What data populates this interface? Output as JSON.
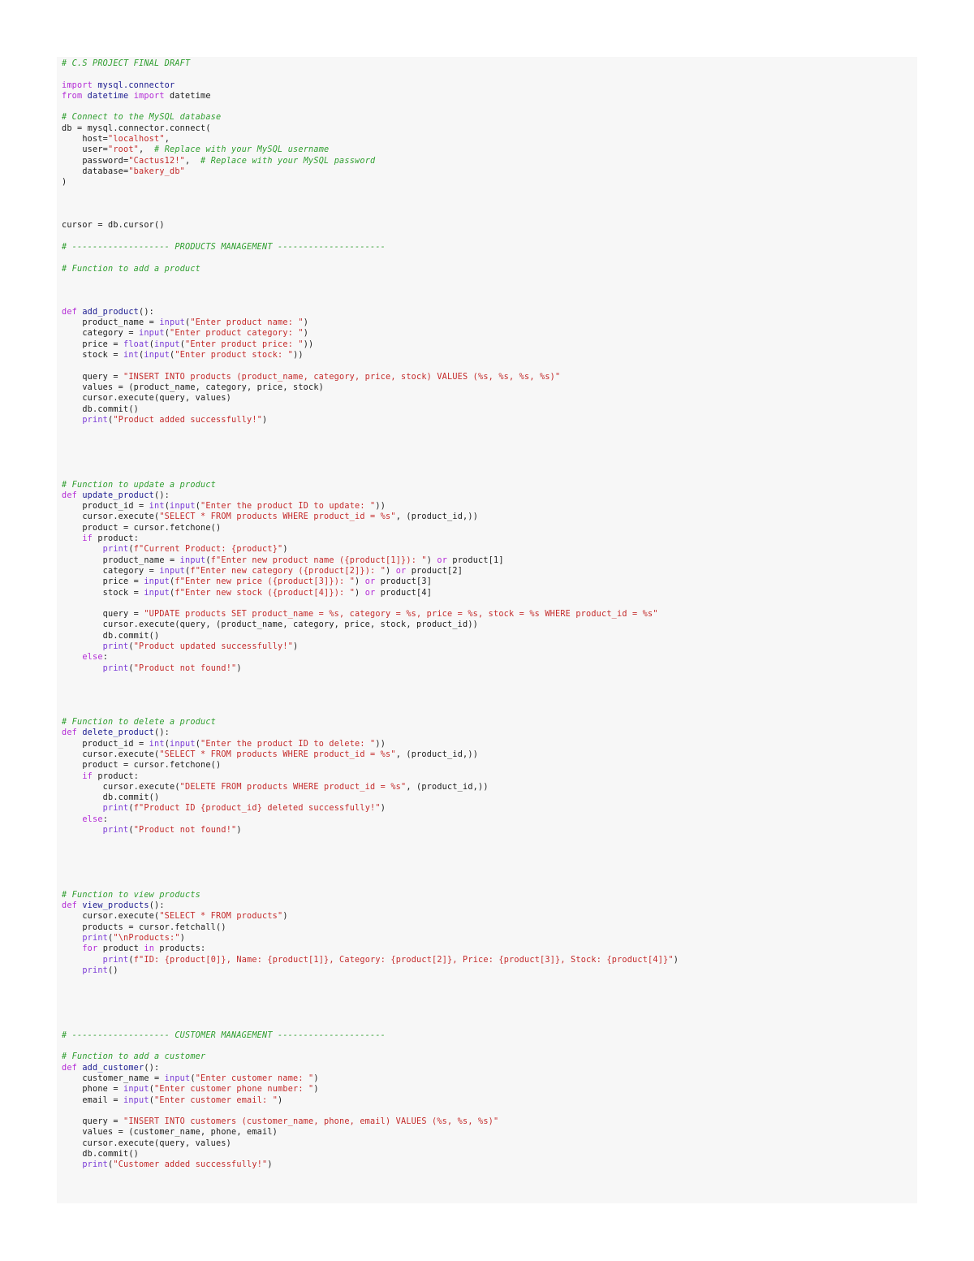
{
  "document": {
    "language": "python",
    "colors": {
      "comment": "#2f9e2f",
      "keyword": "#b32bd6",
      "string": "#c42a2a",
      "function_name": "#1a1a8f",
      "builtin": "#7a3ad6",
      "plain": "#1a1a1a",
      "panel_background": "#f7f7f7"
    },
    "lines": [
      [
        [
          "c",
          "# C.S PROJECT FINAL DRAFT"
        ]
      ],
      [],
      [
        [
          "k",
          "import "
        ],
        [
          "f",
          "mysql.connector"
        ]
      ],
      [
        [
          "k",
          "from "
        ],
        [
          "f",
          "datetime "
        ],
        [
          "k",
          "import "
        ],
        [
          "p",
          "datetime"
        ]
      ],
      [],
      [
        [
          "c",
          "# Connect to the MySQL database"
        ]
      ],
      [
        [
          "p",
          "db = mysql.connector.connect("
        ]
      ],
      [
        [
          "p",
          "    host="
        ],
        [
          "s",
          "\"localhost\""
        ],
        [
          "p",
          ","
        ]
      ],
      [
        [
          "p",
          "    user="
        ],
        [
          "s",
          "\"root\""
        ],
        [
          "p",
          ",  "
        ],
        [
          "c",
          "# Replace with your MySQL username"
        ]
      ],
      [
        [
          "p",
          "    password="
        ],
        [
          "s",
          "\"Cactus12!\""
        ],
        [
          "p",
          ",  "
        ],
        [
          "c",
          "# Replace with your MySQL password"
        ]
      ],
      [
        [
          "p",
          "    database="
        ],
        [
          "s",
          "\"bakery_db\""
        ]
      ],
      [
        [
          "p",
          ")"
        ]
      ],
      [],
      [],
      [],
      [
        [
          "p",
          "cursor = db.cursor()"
        ]
      ],
      [],
      [
        [
          "c",
          "# ------------------- PRODUCTS MANAGEMENT ---------------------"
        ]
      ],
      [],
      [
        [
          "c",
          "# Function to add a product"
        ]
      ],
      [],
      [],
      [],
      [
        [
          "k",
          "def "
        ],
        [
          "f",
          "add_product"
        ],
        [
          "p",
          "():"
        ]
      ],
      [
        [
          "p",
          "    product_name = "
        ],
        [
          "b",
          "input"
        ],
        [
          "p",
          "("
        ],
        [
          "s",
          "\"Enter product name: \""
        ],
        [
          "p",
          ")"
        ]
      ],
      [
        [
          "p",
          "    category = "
        ],
        [
          "b",
          "input"
        ],
        [
          "p",
          "("
        ],
        [
          "s",
          "\"Enter product category: \""
        ],
        [
          "p",
          ")"
        ]
      ],
      [
        [
          "p",
          "    price = "
        ],
        [
          "b",
          "float"
        ],
        [
          "p",
          "("
        ],
        [
          "b",
          "input"
        ],
        [
          "p",
          "("
        ],
        [
          "s",
          "\"Enter product price: \""
        ],
        [
          "p",
          "))"
        ]
      ],
      [
        [
          "p",
          "    stock = "
        ],
        [
          "b",
          "int"
        ],
        [
          "p",
          "("
        ],
        [
          "b",
          "input"
        ],
        [
          "p",
          "("
        ],
        [
          "s",
          "\"Enter product stock: \""
        ],
        [
          "p",
          "))"
        ]
      ],
      [],
      [
        [
          "p",
          "    query = "
        ],
        [
          "s",
          "\"INSERT INTO products (product_name, category, price, stock) VALUES (%s, %s, %s, %s)\""
        ]
      ],
      [
        [
          "p",
          "    values = (product_name, category, price, stock)"
        ]
      ],
      [
        [
          "p",
          "    cursor.execute(query, values)"
        ]
      ],
      [
        [
          "p",
          "    db.commit()"
        ]
      ],
      [
        [
          "p",
          "    "
        ],
        [
          "b",
          "print"
        ],
        [
          "p",
          "("
        ],
        [
          "s",
          "\"Product added successfully!\""
        ],
        [
          "p",
          ")"
        ]
      ],
      [],
      [],
      [],
      [],
      [],
      [
        [
          "c",
          "# Function to update a product"
        ]
      ],
      [
        [
          "k",
          "def "
        ],
        [
          "f",
          "update_product"
        ],
        [
          "p",
          "():"
        ]
      ],
      [
        [
          "p",
          "    product_id = "
        ],
        [
          "b",
          "int"
        ],
        [
          "p",
          "("
        ],
        [
          "b",
          "input"
        ],
        [
          "p",
          "("
        ],
        [
          "s",
          "\"Enter the product ID to update: \""
        ],
        [
          "p",
          "))"
        ]
      ],
      [
        [
          "p",
          "    cursor.execute("
        ],
        [
          "s",
          "\"SELECT * FROM products WHERE product_id = %s\""
        ],
        [
          "p",
          ", (product_id,))"
        ]
      ],
      [
        [
          "p",
          "    product = cursor.fetchone()"
        ]
      ],
      [
        [
          "p",
          "    "
        ],
        [
          "k",
          "if "
        ],
        [
          "p",
          "product:"
        ]
      ],
      [
        [
          "p",
          "        "
        ],
        [
          "b",
          "print"
        ],
        [
          "p",
          "("
        ],
        [
          "s",
          "f\"Current Product: {product}\""
        ],
        [
          "p",
          ")"
        ]
      ],
      [
        [
          "p",
          "        product_name = "
        ],
        [
          "b",
          "input"
        ],
        [
          "p",
          "("
        ],
        [
          "s",
          "f\"Enter new product name ({product[1]}): \""
        ],
        [
          "p",
          ") "
        ],
        [
          "k",
          "or "
        ],
        [
          "p",
          "product[1]"
        ]
      ],
      [
        [
          "p",
          "        category = "
        ],
        [
          "b",
          "input"
        ],
        [
          "p",
          "("
        ],
        [
          "s",
          "f\"Enter new category ({product[2]}): \""
        ],
        [
          "p",
          ") "
        ],
        [
          "k",
          "or "
        ],
        [
          "p",
          "product[2]"
        ]
      ],
      [
        [
          "p",
          "        price = "
        ],
        [
          "b",
          "input"
        ],
        [
          "p",
          "("
        ],
        [
          "s",
          "f\"Enter new price ({product[3]}): \""
        ],
        [
          "p",
          ") "
        ],
        [
          "k",
          "or "
        ],
        [
          "p",
          "product[3]"
        ]
      ],
      [
        [
          "p",
          "        stock = "
        ],
        [
          "b",
          "input"
        ],
        [
          "p",
          "("
        ],
        [
          "s",
          "f\"Enter new stock ({product[4]}): \""
        ],
        [
          "p",
          ") "
        ],
        [
          "k",
          "or "
        ],
        [
          "p",
          "product[4]"
        ]
      ],
      [],
      [
        [
          "p",
          "        query = "
        ],
        [
          "s",
          "\"UPDATE products SET product_name = %s, category = %s, price = %s, stock = %s WHERE product_id = %s\""
        ]
      ],
      [
        [
          "p",
          "        cursor.execute(query, (product_name, category, price, stock, product_id))"
        ]
      ],
      [
        [
          "p",
          "        db.commit()"
        ]
      ],
      [
        [
          "p",
          "        "
        ],
        [
          "b",
          "print"
        ],
        [
          "p",
          "("
        ],
        [
          "s",
          "\"Product updated successfully!\""
        ],
        [
          "p",
          ")"
        ]
      ],
      [
        [
          "p",
          "    "
        ],
        [
          "k",
          "else"
        ],
        [
          "p",
          ":"
        ]
      ],
      [
        [
          "p",
          "        "
        ],
        [
          "b",
          "print"
        ],
        [
          "p",
          "("
        ],
        [
          "s",
          "\"Product not found!\""
        ],
        [
          "p",
          ")"
        ]
      ],
      [],
      [],
      [],
      [],
      [
        [
          "c",
          "# Function to delete a product"
        ]
      ],
      [
        [
          "k",
          "def "
        ],
        [
          "f",
          "delete_product"
        ],
        [
          "p",
          "():"
        ]
      ],
      [
        [
          "p",
          "    product_id = "
        ],
        [
          "b",
          "int"
        ],
        [
          "p",
          "("
        ],
        [
          "b",
          "input"
        ],
        [
          "p",
          "("
        ],
        [
          "s",
          "\"Enter the product ID to delete: \""
        ],
        [
          "p",
          "))"
        ]
      ],
      [
        [
          "p",
          "    cursor.execute("
        ],
        [
          "s",
          "\"SELECT * FROM products WHERE product_id = %s\""
        ],
        [
          "p",
          ", (product_id,))"
        ]
      ],
      [
        [
          "p",
          "    product = cursor.fetchone()"
        ]
      ],
      [
        [
          "p",
          "    "
        ],
        [
          "k",
          "if "
        ],
        [
          "p",
          "product:"
        ]
      ],
      [
        [
          "p",
          "        cursor.execute("
        ],
        [
          "s",
          "\"DELETE FROM products WHERE product_id = %s\""
        ],
        [
          "p",
          ", (product_id,))"
        ]
      ],
      [
        [
          "p",
          "        db.commit()"
        ]
      ],
      [
        [
          "p",
          "        "
        ],
        [
          "b",
          "print"
        ],
        [
          "p",
          "("
        ],
        [
          "s",
          "f\"Product ID {product_id} deleted successfully!\""
        ],
        [
          "p",
          ")"
        ]
      ],
      [
        [
          "p",
          "    "
        ],
        [
          "k",
          "else"
        ],
        [
          "p",
          ":"
        ]
      ],
      [
        [
          "p",
          "        "
        ],
        [
          "b",
          "print"
        ],
        [
          "p",
          "("
        ],
        [
          "s",
          "\"Product not found!\""
        ],
        [
          "p",
          ")"
        ]
      ],
      [],
      [],
      [],
      [],
      [],
      [
        [
          "c",
          "# Function to view products"
        ]
      ],
      [
        [
          "k",
          "def "
        ],
        [
          "f",
          "view_products"
        ],
        [
          "p",
          "():"
        ]
      ],
      [
        [
          "p",
          "    cursor.execute("
        ],
        [
          "s",
          "\"SELECT * FROM products\""
        ],
        [
          "p",
          ")"
        ]
      ],
      [
        [
          "p",
          "    products = cursor.fetchall()"
        ]
      ],
      [
        [
          "p",
          "    "
        ],
        [
          "b",
          "print"
        ],
        [
          "p",
          "("
        ],
        [
          "s",
          "\"\\nProducts:\""
        ],
        [
          "p",
          ")"
        ]
      ],
      [
        [
          "p",
          "    "
        ],
        [
          "k",
          "for "
        ],
        [
          "p",
          "product "
        ],
        [
          "k",
          "in "
        ],
        [
          "p",
          "products:"
        ]
      ],
      [
        [
          "p",
          "        "
        ],
        [
          "b",
          "print"
        ],
        [
          "p",
          "("
        ],
        [
          "s",
          "f\"ID: {product[0]}, Name: {product[1]}, Category: {product[2]}, Price: {product[3]}, Stock: {product[4]}\""
        ],
        [
          "p",
          ")"
        ]
      ],
      [
        [
          "p",
          "    "
        ],
        [
          "b",
          "print"
        ],
        [
          "p",
          "()"
        ]
      ],
      [],
      [],
      [],
      [],
      [],
      [
        [
          "c",
          "# ------------------- CUSTOMER MANAGEMENT ---------------------"
        ]
      ],
      [],
      [
        [
          "c",
          "# Function to add a customer"
        ]
      ],
      [
        [
          "k",
          "def "
        ],
        [
          "f",
          "add_customer"
        ],
        [
          "p",
          "():"
        ]
      ],
      [
        [
          "p",
          "    customer_name = "
        ],
        [
          "b",
          "input"
        ],
        [
          "p",
          "("
        ],
        [
          "s",
          "\"Enter customer name: \""
        ],
        [
          "p",
          ")"
        ]
      ],
      [
        [
          "p",
          "    phone = "
        ],
        [
          "b",
          "input"
        ],
        [
          "p",
          "("
        ],
        [
          "s",
          "\"Enter customer phone number: \""
        ],
        [
          "p",
          ")"
        ]
      ],
      [
        [
          "p",
          "    email = "
        ],
        [
          "b",
          "input"
        ],
        [
          "p",
          "("
        ],
        [
          "s",
          "\"Enter customer email: \""
        ],
        [
          "p",
          ")"
        ]
      ],
      [],
      [
        [
          "p",
          "    query = "
        ],
        [
          "s",
          "\"INSERT INTO customers (customer_name, phone, email) VALUES (%s, %s, %s)\""
        ]
      ],
      [
        [
          "p",
          "    values = (customer_name, phone, email)"
        ]
      ],
      [
        [
          "p",
          "    cursor.execute(query, values)"
        ]
      ],
      [
        [
          "p",
          "    db.commit()"
        ]
      ],
      [
        [
          "p",
          "    "
        ],
        [
          "b",
          "print"
        ],
        [
          "p",
          "("
        ],
        [
          "s",
          "\"Customer added successfully!\""
        ],
        [
          "p",
          ")"
        ]
      ]
    ]
  }
}
